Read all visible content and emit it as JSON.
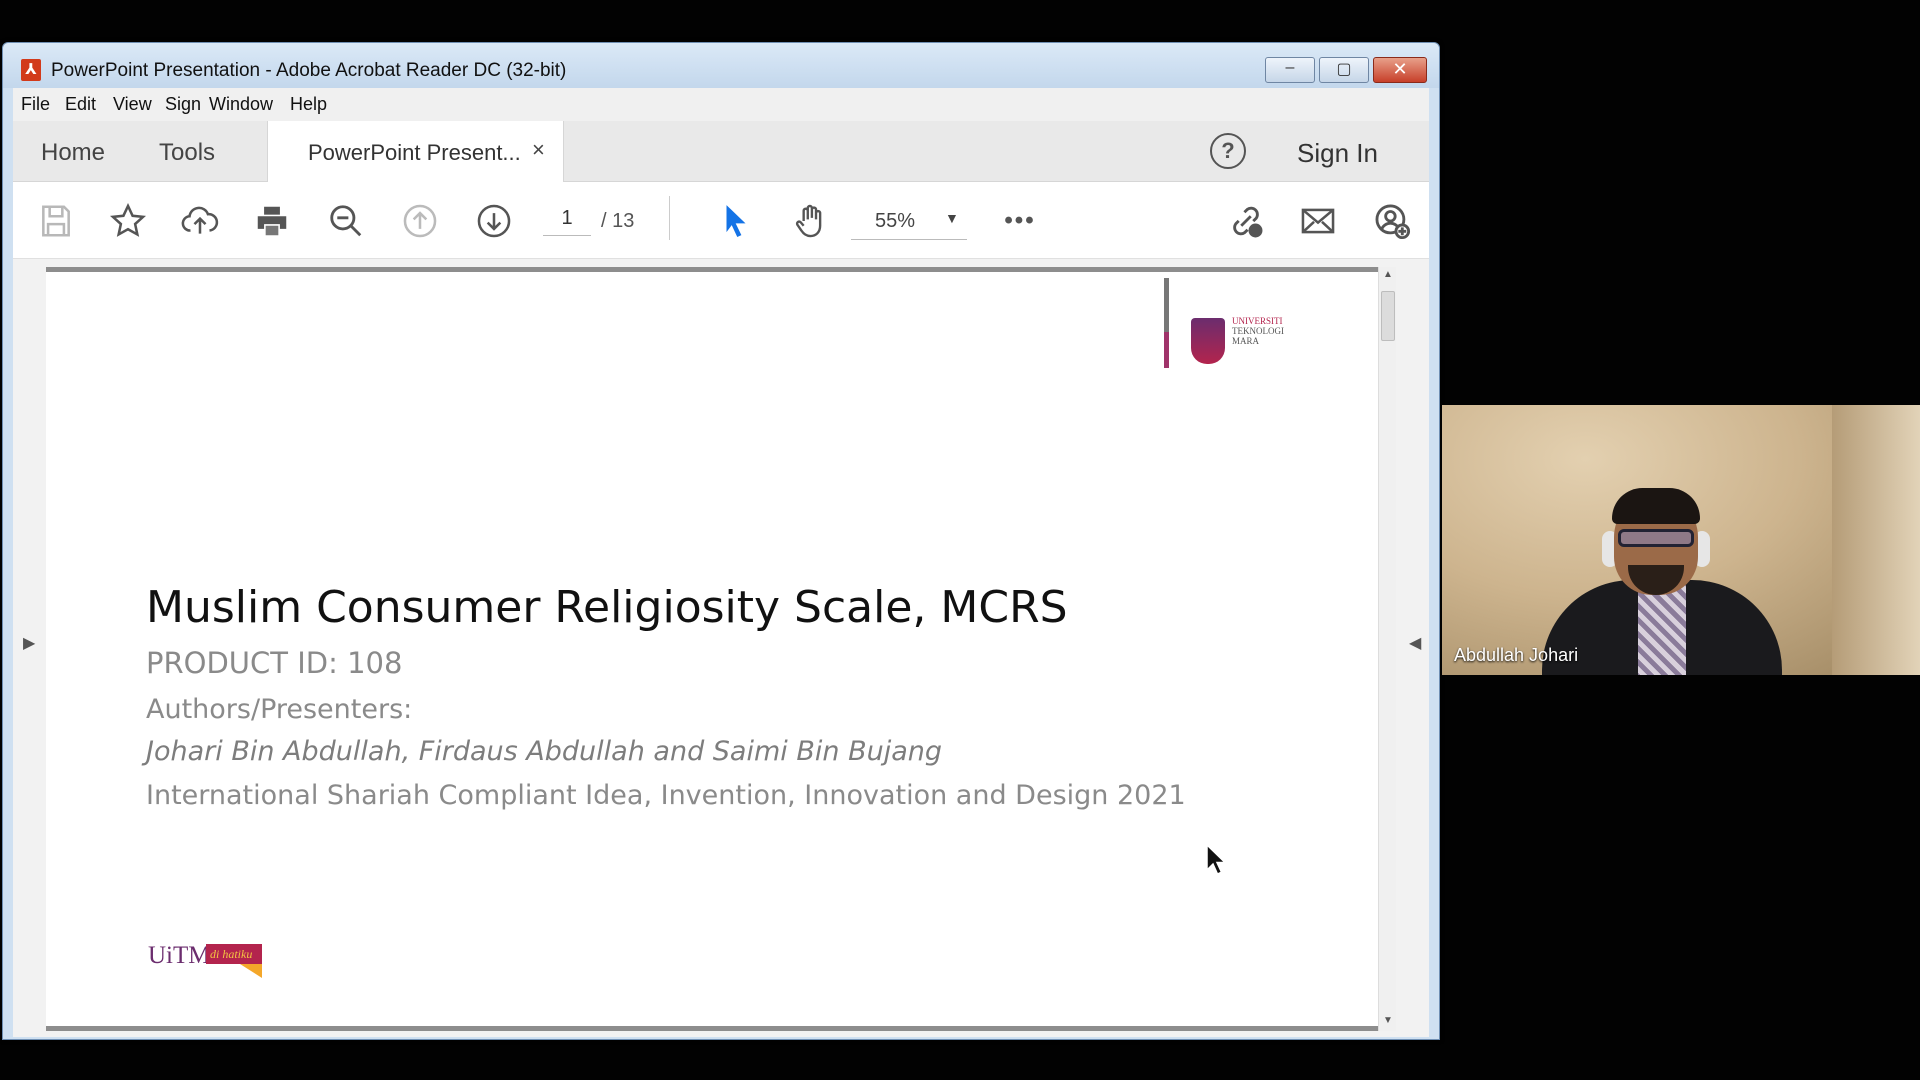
{
  "window": {
    "title": "PowerPoint Presentation - Adobe Acrobat Reader DC (32-bit)",
    "controls": {
      "minimize": "–",
      "maximize": "▢",
      "close": "✕"
    }
  },
  "menu": {
    "items": [
      {
        "label": "File"
      },
      {
        "label": "Edit"
      },
      {
        "label": "View"
      },
      {
        "label": "Sign"
      },
      {
        "label": "Window"
      },
      {
        "label": "Help"
      }
    ]
  },
  "tabs": {
    "home": "Home",
    "tools": "Tools",
    "document": "PowerPoint Present...",
    "close_glyph": "×",
    "help_glyph": "?",
    "sign_in": "Sign In"
  },
  "toolbar": {
    "page_current": "1",
    "page_total": "/ 13",
    "zoom": "55%",
    "more": "•••",
    "icons": [
      "save-icon",
      "star-icon",
      "upload-icon",
      "print-icon",
      "zoom-out-icon",
      "page-up-icon",
      "page-down-icon",
      "select-arrow-icon",
      "hand-icon",
      "zoom-dropdown-icon",
      "more-icon",
      "link-icon",
      "mail-icon",
      "add-user-icon"
    ]
  },
  "slide": {
    "title": "Muslim Consumer Religiosity Scale, MCRS",
    "product_id": "PRODUCT ID: 108",
    "authors_label": "Authors/Presenters:",
    "authors": "Johari Bin Abdullah, Firdaus Abdullah and Saimi Bin Bujang",
    "event": "International Shariah Compliant Idea, Invention, Innovation and Design 2021",
    "crest_text_lines": [
      "UNIVERSITI",
      "TEKNOLOGI",
      "MARA"
    ],
    "footer_logo_text": "UiTM",
    "footer_logo_banner": "di hatiku"
  },
  "webcam": {
    "participant_name": "Abdullah Johari"
  },
  "colors": {
    "accent_purple": "#6b2d6e",
    "accent_maroon": "#b3244d",
    "accent_gold": "#f4a72a",
    "select_tool_blue": "#1473e6"
  }
}
